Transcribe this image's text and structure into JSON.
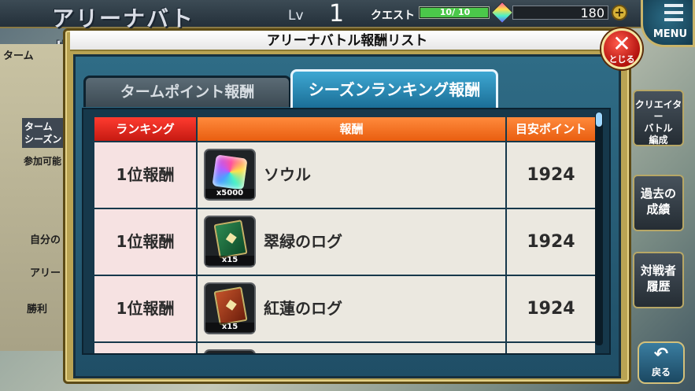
{
  "background": {
    "logo_text": "アリーナバトル",
    "lv_label": "Lv",
    "lv_value": "1",
    "quest_label": "クエスト",
    "quest_bar_text": "10/ 10",
    "quest_fill_fraction": 1.0,
    "gem_count": "180",
    "plus_label": "+",
    "menu_label": "MENU",
    "left_texts": [
      "ターム",
      "ターム",
      "シーズン",
      "参加可能",
      "自分の",
      "アリー",
      "勝利"
    ],
    "side_buttons": [
      "クリエイター\nバトル\n編成",
      "過去の\n成績",
      "対戦者\n履歴"
    ],
    "back_label": "戻る",
    "back_arrow": "↶"
  },
  "modal": {
    "title": "アリーナバトル報酬リスト",
    "close_glyph": "✕",
    "close_label": "とじる",
    "tabs": [
      {
        "label": "タームポイント報酬",
        "active": false
      },
      {
        "label": "シーズンランキング報酬",
        "active": true
      }
    ],
    "table": {
      "headers": {
        "rank": "ランキング",
        "reward": "報酬",
        "points": "目安ポイント"
      },
      "rows": [
        {
          "rank": "1位報酬",
          "item": "ソウル",
          "qty": "x5000",
          "icon": "rainbow-cube-icon",
          "points": "1924"
        },
        {
          "rank": "1位報酬",
          "item": "翠緑のログ",
          "qty": "x15",
          "icon": "green-log-book-icon",
          "points": "1924"
        },
        {
          "rank": "1位報酬",
          "item": "紅蓮のログ",
          "qty": "x15",
          "icon": "red-log-book-icon",
          "points": "1924"
        }
      ]
    }
  },
  "colors": {
    "header_rank": "#d9231a",
    "header_reward": "#f07022",
    "tab_active": "#2a8ab6",
    "close_button": "#d81f17"
  }
}
